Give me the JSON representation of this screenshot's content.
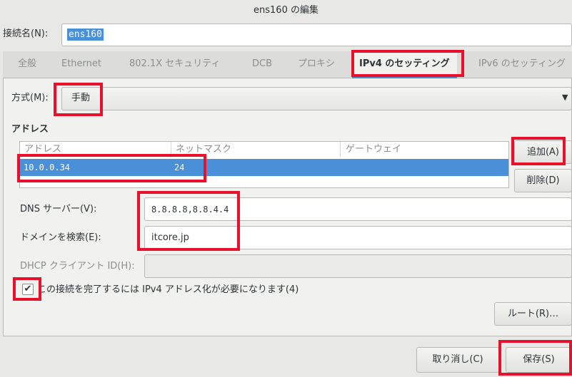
{
  "window": {
    "title": "ens160 の編集"
  },
  "connection": {
    "label": "接続名(N):",
    "value": "ens160"
  },
  "tabs": [
    {
      "label": "全般"
    },
    {
      "label": "Ethernet"
    },
    {
      "label": "802.1X セキュリティ"
    },
    {
      "label": "DCB"
    },
    {
      "label": "プロキシ"
    },
    {
      "label": "IPv4 のセッティング"
    },
    {
      "label": "IPv6 のセッティング"
    }
  ],
  "ipv4": {
    "method_label": "方式(M):",
    "method_value": "手動",
    "addresses_title": "アドレス",
    "columns": [
      "アドレス",
      "ネットマスク",
      "ゲートウェイ"
    ],
    "rows": [
      {
        "address": "10.0.0.34",
        "netmask": "24",
        "gateway": ""
      }
    ],
    "add_button": "追加(A)",
    "delete_button": "削除(D)",
    "dns_label": "DNS サーバー(V):",
    "dns_value": "8.8.8.8,8.8.4.4",
    "search_label": "ドメインを検索(E):",
    "search_value": "itcore.jp",
    "dhcp_label": "DHCP クライアント ID(H):",
    "dhcp_value": "",
    "require_label": "この接続を完了するには IPv4 アドレス化が必要になります(4)",
    "require_checked": "✔",
    "routes_button": "ルート(R)…"
  },
  "footer": {
    "cancel_button": "取り消し(C)",
    "save_button": "保存(S)"
  },
  "colors": {
    "accent": "#4a90d9",
    "highlight": "#e8102a"
  }
}
